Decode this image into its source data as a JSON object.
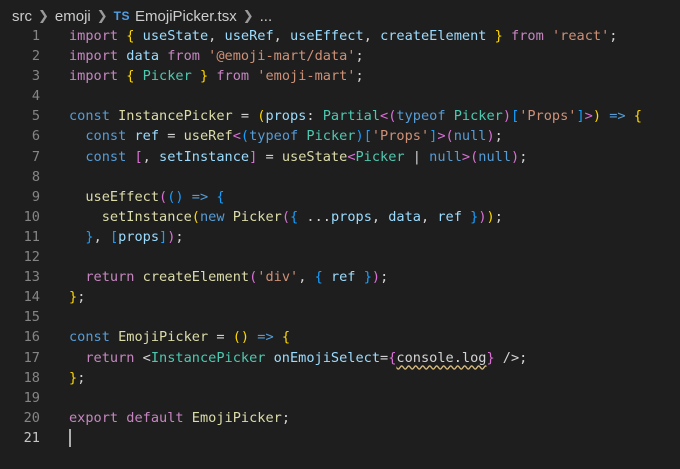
{
  "breadcrumb": {
    "segments": [
      "src",
      "emoji"
    ],
    "file_badge": "TS",
    "file_name": "EmojiPicker.tsx",
    "trailing": "..."
  },
  "editor": {
    "active_line": 21,
    "lines": [
      {
        "n": "1",
        "tokens": [
          [
            "kw",
            "import"
          ],
          [
            "p",
            " "
          ],
          [
            "b1",
            "{"
          ],
          [
            "p",
            " "
          ],
          [
            "var",
            "useState"
          ],
          [
            "p",
            ", "
          ],
          [
            "var",
            "useRef"
          ],
          [
            "p",
            ", "
          ],
          [
            "var",
            "useEffect"
          ],
          [
            "p",
            ", "
          ],
          [
            "var",
            "createElement"
          ],
          [
            "p",
            " "
          ],
          [
            "b1",
            "}"
          ],
          [
            "p",
            " "
          ],
          [
            "kw",
            "from"
          ],
          [
            "p",
            " "
          ],
          [
            "str",
            "'react'"
          ],
          [
            "p",
            ";"
          ]
        ]
      },
      {
        "n": "2",
        "tokens": [
          [
            "kw",
            "import"
          ],
          [
            "p",
            " "
          ],
          [
            "var",
            "data"
          ],
          [
            "p",
            " "
          ],
          [
            "kw",
            "from"
          ],
          [
            "p",
            " "
          ],
          [
            "str",
            "'@emoji-mart/data'"
          ],
          [
            "p",
            ";"
          ]
        ]
      },
      {
        "n": "3",
        "tokens": [
          [
            "kw",
            "import"
          ],
          [
            "p",
            " "
          ],
          [
            "b1",
            "{"
          ],
          [
            "p",
            " "
          ],
          [
            "type",
            "Picker"
          ],
          [
            "p",
            " "
          ],
          [
            "b1",
            "}"
          ],
          [
            "p",
            " "
          ],
          [
            "kw",
            "from"
          ],
          [
            "p",
            " "
          ],
          [
            "str",
            "'emoji-mart'"
          ],
          [
            "p",
            ";"
          ]
        ]
      },
      {
        "n": "4",
        "tokens": []
      },
      {
        "n": "5",
        "tokens": [
          [
            "def",
            "const"
          ],
          [
            "p",
            " "
          ],
          [
            "fn",
            "InstancePicker"
          ],
          [
            "p",
            " = "
          ],
          [
            "b1",
            "("
          ],
          [
            "var",
            "props"
          ],
          [
            "p",
            ": "
          ],
          [
            "type",
            "Partial"
          ],
          [
            "b2",
            "<"
          ],
          [
            "b2",
            "("
          ],
          [
            "def",
            "typeof"
          ],
          [
            "p",
            " "
          ],
          [
            "type",
            "Picker"
          ],
          [
            "b2",
            ")"
          ],
          [
            "b3",
            "["
          ],
          [
            "str",
            "'Props'"
          ],
          [
            "b3",
            "]"
          ],
          [
            "b2",
            ">"
          ],
          [
            "b1",
            ")"
          ],
          [
            "p",
            " "
          ],
          [
            "def",
            "=>"
          ],
          [
            "p",
            " "
          ],
          [
            "b1",
            "{"
          ]
        ]
      },
      {
        "n": "6",
        "tokens": [
          [
            "p",
            "  "
          ],
          [
            "def",
            "const"
          ],
          [
            "p",
            " "
          ],
          [
            "var",
            "ref"
          ],
          [
            "p",
            " = "
          ],
          [
            "fn",
            "useRef"
          ],
          [
            "b2",
            "<"
          ],
          [
            "b3",
            "("
          ],
          [
            "def",
            "typeof"
          ],
          [
            "p",
            " "
          ],
          [
            "type",
            "Picker"
          ],
          [
            "b3",
            ")"
          ],
          [
            "b3",
            "["
          ],
          [
            "str",
            "'Props'"
          ],
          [
            "b3",
            "]"
          ],
          [
            "b2",
            ">"
          ],
          [
            "b2",
            "("
          ],
          [
            "def",
            "null"
          ],
          [
            "b2",
            ")"
          ],
          [
            "p",
            ";"
          ]
        ]
      },
      {
        "n": "7",
        "tokens": [
          [
            "p",
            "  "
          ],
          [
            "def",
            "const"
          ],
          [
            "p",
            " "
          ],
          [
            "b2",
            "["
          ],
          [
            "p",
            ", "
          ],
          [
            "var",
            "setInstance"
          ],
          [
            "b2",
            "]"
          ],
          [
            "p",
            " = "
          ],
          [
            "fn",
            "useState"
          ],
          [
            "b2",
            "<"
          ],
          [
            "type",
            "Picker"
          ],
          [
            "p",
            " | "
          ],
          [
            "def",
            "null"
          ],
          [
            "b2",
            ">"
          ],
          [
            "b2",
            "("
          ],
          [
            "def",
            "null"
          ],
          [
            "b2",
            ")"
          ],
          [
            "p",
            ";"
          ]
        ]
      },
      {
        "n": "8",
        "tokens": []
      },
      {
        "n": "9",
        "tokens": [
          [
            "p",
            "  "
          ],
          [
            "fn",
            "useEffect"
          ],
          [
            "b2",
            "("
          ],
          [
            "b3",
            "()"
          ],
          [
            "p",
            " "
          ],
          [
            "def",
            "=>"
          ],
          [
            "p",
            " "
          ],
          [
            "b3",
            "{"
          ]
        ]
      },
      {
        "n": "10",
        "tokens": [
          [
            "p",
            "    "
          ],
          [
            "fn",
            "setInstance"
          ],
          [
            "b1",
            "("
          ],
          [
            "def",
            "new"
          ],
          [
            "p",
            " "
          ],
          [
            "fn",
            "Picker"
          ],
          [
            "b2",
            "("
          ],
          [
            "b3",
            "{"
          ],
          [
            "p",
            " ..."
          ],
          [
            "var",
            "props"
          ],
          [
            "p",
            ", "
          ],
          [
            "var",
            "data"
          ],
          [
            "p",
            ", "
          ],
          [
            "var",
            "ref"
          ],
          [
            "p",
            " "
          ],
          [
            "b3",
            "}"
          ],
          [
            "b2",
            ")"
          ],
          [
            "b1",
            ")"
          ],
          [
            "p",
            ";"
          ]
        ]
      },
      {
        "n": "11",
        "tokens": [
          [
            "p",
            "  "
          ],
          [
            "b3",
            "}"
          ],
          [
            "p",
            ", "
          ],
          [
            "b3",
            "["
          ],
          [
            "var",
            "props"
          ],
          [
            "b3",
            "]"
          ],
          [
            "b2",
            ")"
          ],
          [
            "p",
            ";"
          ]
        ]
      },
      {
        "n": "12",
        "tokens": []
      },
      {
        "n": "13",
        "tokens": [
          [
            "p",
            "  "
          ],
          [
            "kw",
            "return"
          ],
          [
            "p",
            " "
          ],
          [
            "fn",
            "createElement"
          ],
          [
            "b2",
            "("
          ],
          [
            "str",
            "'div'"
          ],
          [
            "p",
            ", "
          ],
          [
            "b3",
            "{"
          ],
          [
            "p",
            " "
          ],
          [
            "var",
            "ref"
          ],
          [
            "p",
            " "
          ],
          [
            "b3",
            "}"
          ],
          [
            "b2",
            ")"
          ],
          [
            "p",
            ";"
          ]
        ]
      },
      {
        "n": "14",
        "tokens": [
          [
            "b1",
            "}"
          ],
          [
            "p",
            ";"
          ]
        ]
      },
      {
        "n": "15",
        "tokens": []
      },
      {
        "n": "16",
        "tokens": [
          [
            "def",
            "const"
          ],
          [
            "p",
            " "
          ],
          [
            "fn",
            "EmojiPicker"
          ],
          [
            "p",
            " = "
          ],
          [
            "b1",
            "()"
          ],
          [
            "p",
            " "
          ],
          [
            "def",
            "=>"
          ],
          [
            "p",
            " "
          ],
          [
            "b1",
            "{"
          ]
        ]
      },
      {
        "n": "17",
        "tokens": [
          [
            "p",
            "  "
          ],
          [
            "kw",
            "return"
          ],
          [
            "p",
            " "
          ],
          [
            "p",
            "<"
          ],
          [
            "tag",
            "InstancePicker"
          ],
          [
            "p",
            " "
          ],
          [
            "attr",
            "onEmojiSelect"
          ],
          [
            "p",
            "="
          ],
          [
            "b2",
            "{"
          ],
          [
            "squig",
            "console.log"
          ],
          [
            "b2",
            "}"
          ],
          [
            "p",
            " />;"
          ]
        ]
      },
      {
        "n": "18",
        "tokens": [
          [
            "b1",
            "}"
          ],
          [
            "p",
            ";"
          ]
        ]
      },
      {
        "n": "19",
        "tokens": []
      },
      {
        "n": "20",
        "tokens": [
          [
            "kw",
            "export"
          ],
          [
            "p",
            " "
          ],
          [
            "kw",
            "default"
          ],
          [
            "p",
            " "
          ],
          [
            "fn",
            "EmojiPicker"
          ],
          [
            "p",
            ";"
          ]
        ]
      },
      {
        "n": "21",
        "tokens": []
      }
    ]
  }
}
